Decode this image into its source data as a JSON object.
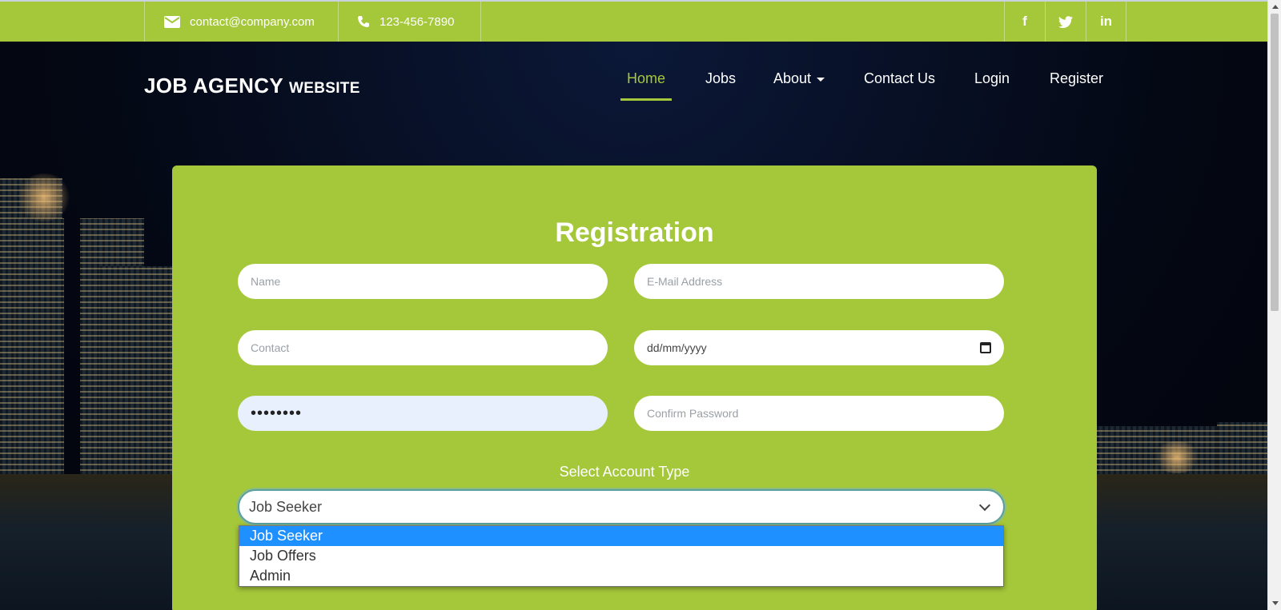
{
  "topbar": {
    "email": "contact@company.com",
    "phone": "123-456-7890",
    "social": {
      "facebook": "f",
      "twitter": "twitter-icon",
      "linkedin": "in"
    }
  },
  "brand": {
    "main": "JOB AGENCY",
    "sub": "WEBSITE"
  },
  "nav": {
    "home": "Home",
    "jobs": "Jobs",
    "about": "About",
    "contact": "Contact Us",
    "login": "Login",
    "register": "Register"
  },
  "form": {
    "title": "Registration",
    "name_placeholder": "Name",
    "email_placeholder": "E-Mail Address",
    "contact_placeholder": "Contact",
    "date_value": "dd/mm/yyyy",
    "password_value": "••••••••",
    "confirm_placeholder": "Confirm Password",
    "account_label": "Select Account Type",
    "account_selected": "Job Seeker",
    "account_options": [
      "Job Seeker",
      "Job Offers",
      "Admin"
    ]
  },
  "colors": {
    "accent": "#a5c73a",
    "selected_option": "#1e90ff"
  }
}
